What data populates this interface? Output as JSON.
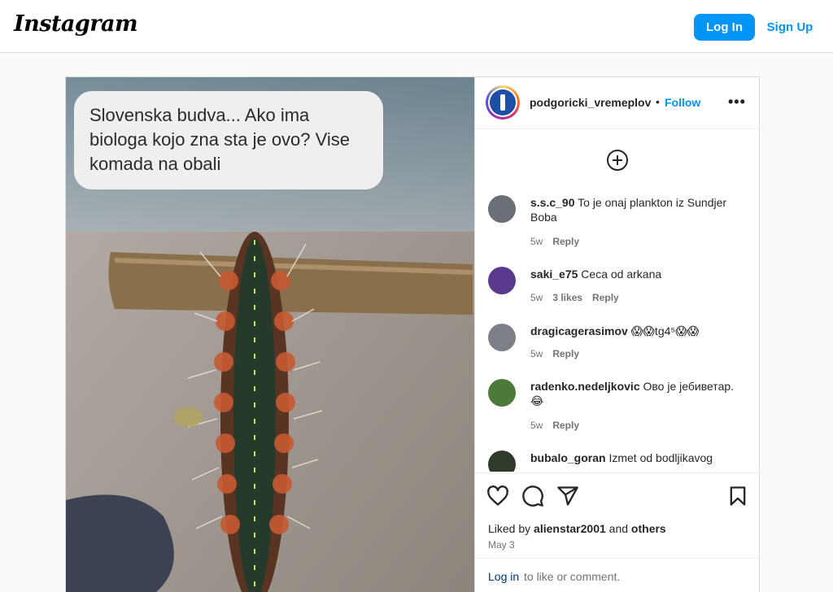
{
  "header": {
    "logo": "Instagram",
    "login_label": "Log In",
    "signup_label": "Sign Up"
  },
  "post": {
    "caption_image_text": "Slovenska budva... Ako ima biologa kojo zna sta je ovo? Vise komada na obali",
    "author": "podgoricki_vremeplov",
    "separator": "•",
    "follow_label": "Follow",
    "more_label": "•••",
    "comments": [
      {
        "user": "s.s.c_90",
        "text": "To je onaj plankton iz Sundjer Boba",
        "age": "5w",
        "likes": "",
        "reply": "Reply",
        "avatar_color": "#6b6f78"
      },
      {
        "user": "saki_e75",
        "text": "Ceca od arkana",
        "age": "5w",
        "likes": "3 likes",
        "reply": "Reply",
        "avatar_color": "#5a3a8c"
      },
      {
        "user": "dragicagerasimov",
        "text": "😱😱tg4⁵😱😱",
        "age": "5w",
        "likes": "",
        "reply": "Reply",
        "avatar_color": "#7d7f86"
      },
      {
        "user": "radenko.nedeljkovic",
        "text": "Ово је јебиветар. 😂",
        "age": "5w",
        "likes": "",
        "reply": "Reply",
        "avatar_color": "#4c7a3a"
      },
      {
        "user": "bubalo_goran",
        "text": "Izmet od bodljikavog",
        "age": "",
        "likes": "",
        "reply": "",
        "avatar_color": "#2f3b2a"
      }
    ],
    "liked_prefix": "Liked by ",
    "liked_user": "alienstar2001",
    "liked_mid": " and ",
    "liked_others": "others",
    "date": "May 3",
    "login_link": "Log in",
    "login_rest": " to like or comment."
  },
  "icons": [
    "heart-icon",
    "comment-icon",
    "share-icon",
    "bookmark-icon",
    "add-circle-icon",
    "more-icon"
  ],
  "colors": {
    "accent": "#0095f6",
    "text": "#262626",
    "muted": "#737373",
    "border": "#dbdbdb"
  }
}
